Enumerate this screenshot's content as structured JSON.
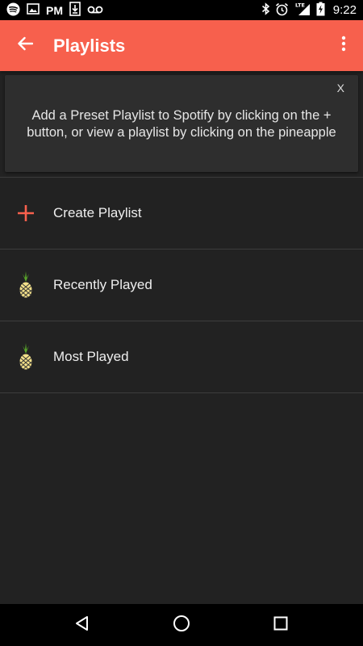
{
  "status_bar": {
    "left_text": "PM",
    "network": "LTE",
    "time": "9:22",
    "icons": [
      "spotify-icon",
      "image-icon",
      "download-icon",
      "voicemail-icon",
      "bluetooth-icon",
      "alarm-icon",
      "signal-icon",
      "battery-charging-icon"
    ]
  },
  "app_bar": {
    "title": "Playlists",
    "background_color": "#f7604d"
  },
  "info_card": {
    "close_label": "X",
    "message": "Add a Preset Playlist to Spotify by clicking on the + button, or view a playlist by clicking on the pineapple"
  },
  "list": {
    "items": [
      {
        "label": "Create Playlist",
        "icon": "plus-icon"
      },
      {
        "label": "Recently Played",
        "icon": "pineapple-icon"
      },
      {
        "label": "Most Played",
        "icon": "pineapple-icon"
      }
    ]
  },
  "nav_bar": {
    "icons": [
      "back-triangle-icon",
      "home-circle-icon",
      "recents-square-icon"
    ]
  },
  "colors": {
    "accent": "#f7604d",
    "background": "#222222",
    "card": "#2e2e2e"
  }
}
